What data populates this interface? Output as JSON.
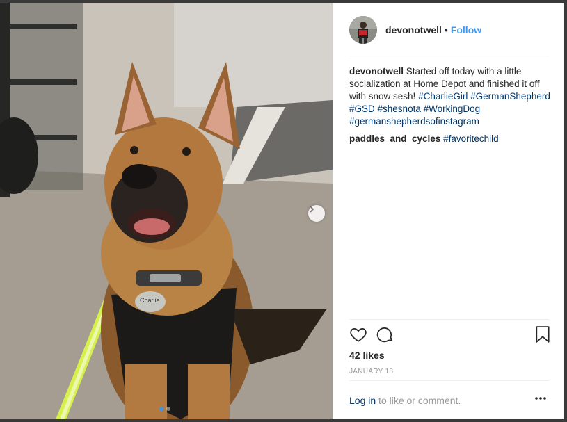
{
  "post": {
    "username": "devonotwell",
    "separator": "•",
    "follow_label": "Follow",
    "caption": {
      "user": "devonotwell",
      "text": "Started off today with a little socialization at Home Depot and finished it off with snow sesh!",
      "hashtags": [
        "#CharlieGirl",
        "#GermanShepherd",
        "#GSD",
        "#shesnota",
        "#WorkingDog",
        "#germanshepherdsofinstagram"
      ]
    },
    "comments": [
      {
        "user": "paddles_and_cycles",
        "tag": "#favoritechild"
      }
    ],
    "likes": "42 likes",
    "date": "JANUARY 18",
    "footer": {
      "login": "Log in",
      "rest": "to like or comment."
    },
    "photo_tag_text": "Charlie",
    "carousel": {
      "count": 2,
      "active": 1
    }
  },
  "icons": {
    "like": "heart-icon",
    "comment": "comment-icon",
    "save": "bookmark-icon",
    "next": "chevron-right-icon",
    "more": "more-options-icon"
  },
  "colors": {
    "link": "#3897f0",
    "hashtag": "#003569",
    "muted": "#999999"
  }
}
